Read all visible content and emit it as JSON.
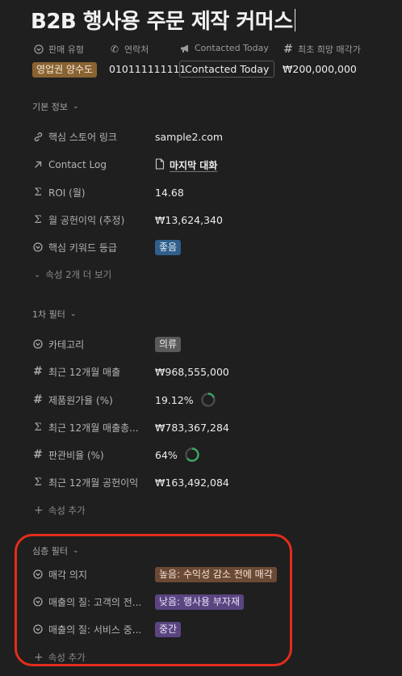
{
  "page": {
    "title": "B2B 행사용 주문 제작 커머스"
  },
  "header_props": [
    {
      "label": "판매 유형",
      "icon": "select-icon",
      "value": "영업권 양수도",
      "value_style": "tag",
      "color": "#8a6332"
    },
    {
      "label": "연락처",
      "icon": "phone-icon",
      "value": "010111111111",
      "value_style": "text"
    },
    {
      "label": "Contacted Today",
      "icon": "megaphone-icon",
      "value": "Contacted Today",
      "value_style": "boxed"
    },
    {
      "label": "최초 희망 매각가",
      "icon": "hash-icon",
      "value": "₩200,000,000",
      "value_style": "text"
    }
  ],
  "sections": {
    "basic": {
      "title": "기본 정보",
      "rows": [
        {
          "label": "핵심 스토어 링크",
          "icon": "link-icon",
          "value": "sample2.com"
        },
        {
          "label": "Contact Log",
          "icon": "arrow-up-right-icon",
          "value": "마지막 대화"
        },
        {
          "label": "ROI (월)",
          "icon": "sigma-icon",
          "value": "14.68"
        },
        {
          "label": "월 공헌이익 (추정)",
          "icon": "sigma-icon",
          "value": "₩13,624,340"
        },
        {
          "label": "핵심 키워드 등급",
          "icon": "select-icon",
          "value": "좋음",
          "color": "#2f5f8a"
        }
      ],
      "more_label": "속성 2개 더 보기"
    },
    "filter1": {
      "title": "1차 필터",
      "rows": [
        {
          "label": "카테고리",
          "icon": "select-icon",
          "value": "의류"
        },
        {
          "label": "최근 12개월 매출",
          "icon": "hash-icon",
          "value": "₩968,555,000"
        },
        {
          "label": "제품원가율 (%)",
          "icon": "hash-icon",
          "value": "19.12%",
          "ring_fraction": 0.19
        },
        {
          "label": "최근 12개월 매출총...",
          "icon": "sigma-icon",
          "value": "₩783,367,284"
        },
        {
          "label": "판관비율 (%)",
          "icon": "hash-icon",
          "value": "64%",
          "ring_fraction": 0.64
        },
        {
          "label": "최근 12개월 공헌이익",
          "icon": "sigma-icon",
          "value": "₩163,492,084"
        }
      ],
      "add_label": "속성 추가"
    },
    "deep": {
      "title": "심층 필터",
      "rows": [
        {
          "label": "매각 의지",
          "icon": "select-icon",
          "value": "높음: 수익성 감소 전에 매각"
        },
        {
          "label": "매출의 질: 고객의 전...",
          "icon": "select-icon",
          "value": "낮음: 행사용 부자재"
        },
        {
          "label": "매출의 질: 서비스 중...",
          "icon": "select-icon",
          "value": "중간"
        }
      ],
      "add_label": "속성 추가"
    }
  },
  "colors": {
    "background": "#1f1f1f",
    "highlight": "#e22d1c",
    "ring_progress": "#3aa865"
  }
}
